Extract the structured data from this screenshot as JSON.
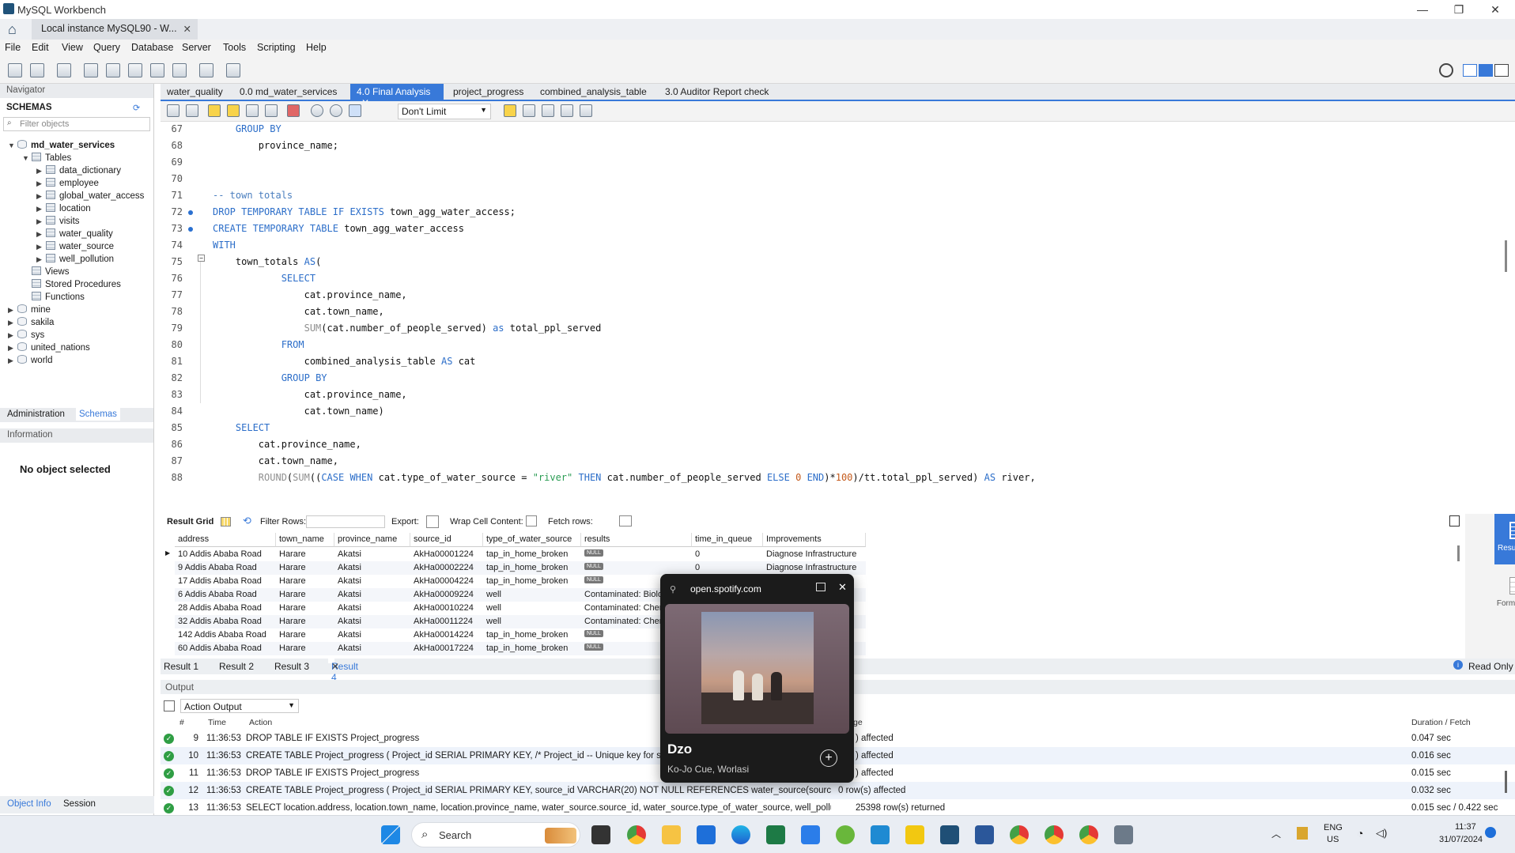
{
  "window": {
    "title": "MySQL Workbench",
    "connection_tab": "Local instance MySQL90 - W...",
    "min": "—",
    "max": "❐",
    "close": "✕"
  },
  "menu": [
    "File",
    "Edit",
    "View",
    "Query",
    "Database",
    "Server",
    "Tools",
    "Scripting",
    "Help"
  ],
  "navigator": {
    "title": "Navigator",
    "schemas_label": "SCHEMAS",
    "filter_placeholder": "Filter objects",
    "schema": "md_water_services",
    "tables_label": "Tables",
    "tables": [
      "data_dictionary",
      "employee",
      "global_water_access",
      "location",
      "visits",
      "water_quality",
      "water_source",
      "well_pollution"
    ],
    "views": "Views",
    "procs": "Stored Procedures",
    "funcs": "Functions",
    "other_schemas": [
      "mine",
      "sakila",
      "sys",
      "united_nations",
      "world"
    ],
    "tab_admin": "Administration",
    "tab_schemas": "Schemas",
    "info_label": "Information",
    "no_object": "No object selected",
    "tab_objinfo": "Object Info",
    "tab_session": "Session"
  },
  "editor_tabs": [
    "water_quality",
    "0.0 md_water_services",
    "4.0 Final Analysis",
    "project_progress",
    "combined_analysis_table",
    "3.0 Auditor Report check"
  ],
  "limit": "Don't Limit",
  "code_lines": [
    {
      "n": "67",
      "t": "    GROUP BY",
      "k": "kw"
    },
    {
      "n": "68",
      "t": "        province_name;"
    },
    {
      "n": "69",
      "t": ""
    },
    {
      "n": "70",
      "t": ""
    },
    {
      "n": "71",
      "t": "-- town totals",
      "k": "cm"
    },
    {
      "n": "72",
      "t": "DROP TEMPORARY TABLE IF EXISTS town_agg_water_access;",
      "dot": true
    },
    {
      "n": "73",
      "t": "CREATE TEMPORARY TABLE town_agg_water_access",
      "dot": true
    },
    {
      "n": "74",
      "t": "WITH"
    },
    {
      "n": "75",
      "t": "    town_totals AS("
    },
    {
      "n": "76",
      "t": "            SELECT"
    },
    {
      "n": "77",
      "t": "                cat.province_name,"
    },
    {
      "n": "78",
      "t": "                cat.town_name,"
    },
    {
      "n": "79",
      "t": "                SUM(cat.number_of_people_served) as total_ppl_served"
    },
    {
      "n": "80",
      "t": "            FROM"
    },
    {
      "n": "81",
      "t": "                combined_analysis_table AS cat"
    },
    {
      "n": "82",
      "t": "            GROUP BY"
    },
    {
      "n": "83",
      "t": "                cat.province_name,"
    },
    {
      "n": "84",
      "t": "                cat.town_name)"
    },
    {
      "n": "85",
      "t": "    SELECT"
    },
    {
      "n": "86",
      "t": "        cat.province_name,"
    },
    {
      "n": "87",
      "t": "        cat.town_name,"
    },
    {
      "n": "88",
      "t": "        ROUND(SUM((CASE WHEN cat.type_of_water_source = \"river\" THEN cat.number_of_people_served ELSE 0 END)*100)/tt.total_ppl_served) AS river,"
    }
  ],
  "result_toolbar": {
    "grid": "Result Grid",
    "filter": "Filter Rows:",
    "export": "Export:",
    "wrap": "Wrap Cell Content:",
    "fetch": "Fetch rows:"
  },
  "grid_cols": [
    "address",
    "town_name",
    "province_name",
    "source_id",
    "type_of_water_source",
    "results",
    "time_in_queue",
    "Improvements"
  ],
  "grid_rows": [
    [
      "10 Addis Ababa Road",
      "Harare",
      "Akatsi",
      "AkHa00001224",
      "tap_in_home_broken",
      "NULL",
      "0",
      "Diagnose Infrastructure"
    ],
    [
      "9 Addis Ababa Road",
      "Harare",
      "Akatsi",
      "AkHa00002224",
      "tap_in_home_broken",
      "NULL",
      "0",
      "Diagnose Infrastructure"
    ],
    [
      "17 Addis Ababa Road",
      "Harare",
      "Akatsi",
      "AkHa00004224",
      "tap_in_home_broken",
      "NULL",
      "",
      ""
    ],
    [
      "6 Addis Ababa Road",
      "Harare",
      "Akatsi",
      "AkHa00009224",
      "well",
      "Contaminated: Biolog",
      "",
      ""
    ],
    [
      "28 Addis Ababa Road",
      "Harare",
      "Akatsi",
      "AkHa00010224",
      "well",
      "Contaminated: Chem",
      "",
      ""
    ],
    [
      "32 Addis Ababa Road",
      "Harare",
      "Akatsi",
      "AkHa00011224",
      "well",
      "Contaminated: Chem",
      "",
      ""
    ],
    [
      "142 Addis Ababa Road",
      "Harare",
      "Akatsi",
      "AkHa00014224",
      "tap_in_home_broken",
      "NULL",
      "",
      ""
    ],
    [
      "60 Addis Ababa Road",
      "Harare",
      "Akatsi",
      "AkHa00017224",
      "tap_in_home_broken",
      "NULL",
      "",
      ""
    ]
  ],
  "result_tabs": [
    "Result 1",
    "Result 2",
    "Result 3",
    "Result 4"
  ],
  "right_pane": {
    "grid": "Result Grid",
    "form": "Form Editor",
    "readonly": "Read Only"
  },
  "output": {
    "title": "Output",
    "selector": "Action Output",
    "cols": {
      "num": "#",
      "time": "Time",
      "action": "Action",
      "msg": "ge",
      "dur": "Duration / Fetch"
    },
    "rows": [
      {
        "n": "9",
        "time": "11:36:53",
        "action": "DROP TABLE IF EXISTS Project_progress",
        "msg": ") affected",
        "dur": "0.047 sec"
      },
      {
        "n": "10",
        "time": "11:36:53",
        "action": "CREATE TABLE Project_progress ( Project_id SERIAL PRIMARY KEY, /* Project_id -- Unique key for sources",
        "msg": ") affected",
        "dur": "0.016 sec"
      },
      {
        "n": "11",
        "time": "11:36:53",
        "action": "DROP TABLE IF EXISTS Project_progress",
        "msg": ") affected",
        "dur": "0.015 sec"
      },
      {
        "n": "12",
        "time": "11:36:53",
        "action": "CREATE TABLE Project_progress ( Project_id SERIAL PRIMARY KEY, source_id VARCHAR(20) NOT NULL REFERENCES water_source(source_id) ...",
        "msg": "0 row(s) affected",
        "dur": "0.032 sec"
      },
      {
        "n": "13",
        "time": "11:36:53",
        "action": "SELECT location.address, location.town_name, location.province_name, water_source.source_id, water_source.type_of_water_source, well_pollution.re...",
        "msg": "25398 row(s) returned",
        "dur": "0.015 sec / 0.422 sec"
      }
    ]
  },
  "spotify": {
    "site": "open.spotify.com",
    "song": "Dzo",
    "artist": "Ko-Jo Cue, Worlasi"
  },
  "taskbar": {
    "search": "Search",
    "lang1": "ENG",
    "lang2": "US",
    "time": "11:37",
    "date": "31/07/2024"
  }
}
